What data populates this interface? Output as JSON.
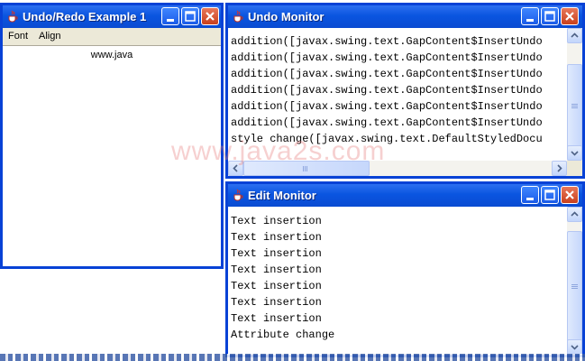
{
  "windows": {
    "undo_redo": {
      "title": "Undo/Redo Example 1",
      "menu": [
        "Font",
        "Align"
      ],
      "document_text": "www.java"
    },
    "undo_monitor": {
      "title": "Undo Monitor",
      "lines": [
        "addition([javax.swing.text.GapContent$InsertUndo",
        "addition([javax.swing.text.GapContent$InsertUndo",
        "addition([javax.swing.text.GapContent$InsertUndo",
        "addition([javax.swing.text.GapContent$InsertUndo",
        "addition([javax.swing.text.GapContent$InsertUndo",
        "addition([javax.swing.text.GapContent$InsertUndo",
        "style change([javax.swing.text.DefaultStyledDocu"
      ]
    },
    "edit_monitor": {
      "title": "Edit Monitor",
      "lines": [
        "Text insertion",
        "Text insertion",
        "Text insertion",
        "Text insertion",
        "Text insertion",
        "Text insertion",
        "Text insertion",
        "Attribute change"
      ]
    }
  },
  "watermark": "www.java2s.com",
  "icons": {
    "app": "java-cup-icon",
    "minimize": "minimize-icon",
    "maximize": "maximize-icon",
    "close": "close-icon"
  },
  "colors": {
    "titlebar": "#0a55e0",
    "close_button": "#c9401c",
    "window_frame": "#0842d6"
  }
}
